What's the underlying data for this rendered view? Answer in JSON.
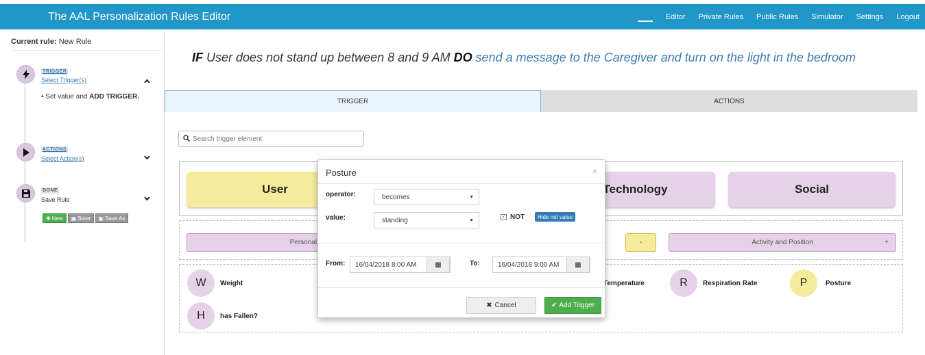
{
  "app": {
    "title": "The AAL Personalization Rules Editor"
  },
  "nav": [
    "Editor",
    "Private Rules",
    "Public Rules",
    "Simulator",
    "Settings",
    "Logout"
  ],
  "sidebar": {
    "current_rule_label": "Current rule:",
    "current_rule_value": "New Rule",
    "steps": [
      {
        "tag": "TRIGGER",
        "sub": "Select Trigger(s)",
        "icon": "lightning-icon",
        "chevron": "up"
      },
      {
        "tag": "ACTIONS",
        "sub": "Select Action(s)",
        "icon": "play-icon",
        "chevron": "down"
      },
      {
        "tag": "DONE",
        "sub": "Save Rule",
        "icon": "save-icon",
        "chevron": "down"
      }
    ],
    "trigger_note_prefix": "Set value and ",
    "trigger_note_bold": "ADD TRIGGER.",
    "buttons": {
      "new": "New",
      "save": "Save",
      "save_as": "Save As"
    }
  },
  "rule": {
    "if_kw": "IF",
    "condition": "User does not stand up between 8 and 9 AM",
    "do_kw": "DO",
    "action": "send a message to the Caregiver and turn on the light in the bedroom"
  },
  "tabs": {
    "trigger": "TRIGGER",
    "actions": "ACTIONS"
  },
  "search": {
    "placeholder": "Search trigger element"
  },
  "categories": {
    "user": "User",
    "technology": "Technology",
    "social": "Social"
  },
  "subcategories": {
    "personal": "Personal Data",
    "mid_symbol": "-",
    "activity": "Activity and Position",
    "activity_symbol": "+"
  },
  "items": [
    {
      "letter": "W",
      "label": "Weight"
    },
    {
      "letter": "R",
      "label": "Respiration Rate"
    },
    {
      "letter": "P",
      "label": "Posture"
    },
    {
      "letter": "H",
      "label": "has Fallen?"
    },
    {
      "letter": "",
      "label": "Temperature"
    }
  ],
  "modal": {
    "title": "Posture",
    "close": "×",
    "operator_label": "operator:",
    "operator_value": "becomes",
    "value_label": "value:",
    "value_value": "standing",
    "not_label": "NOT",
    "hide_not_button": "Hide not value",
    "from_label": "From:",
    "from_value": "16/04/2018 8:00 AM",
    "to_label": "To:",
    "to_value": "16/04/2018 9:00 AM",
    "cancel_button": "Cancel",
    "add_button": "Add Trigger"
  },
  "colors": {
    "navbar": "#2196c8",
    "user_yellow": "#f5eb9a",
    "lilac": "#e5d2e8",
    "link_blue": "#3b7bb5",
    "success": "#4cae4c"
  }
}
